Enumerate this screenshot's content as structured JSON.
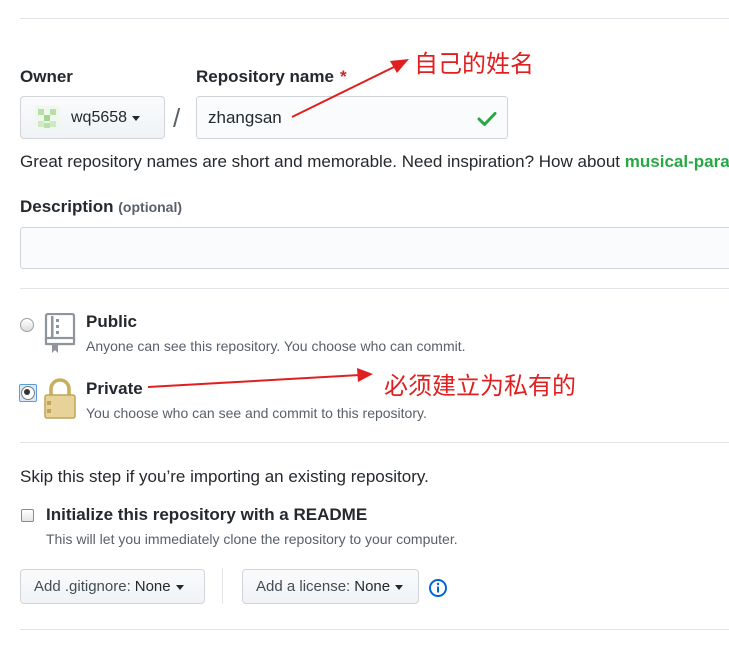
{
  "owner": {
    "label": "Owner",
    "username": "wq5658"
  },
  "repository": {
    "label": "Repository name",
    "required_mark": "*",
    "separator": "/",
    "value": "zhangsan"
  },
  "name_hint": {
    "text": "Great repository names are short and memorable. Need inspiration? How about ",
    "suggestion": "musical-parakeet"
  },
  "description": {
    "label": "Description",
    "optional": "(optional)",
    "value": ""
  },
  "visibility": {
    "public": {
      "title": "Public",
      "desc": "Anyone can see this repository. You choose who can commit.",
      "selected": false
    },
    "private": {
      "title": "Private",
      "desc": "You choose who can see and commit to this repository.",
      "selected": true
    }
  },
  "skip_text": "Skip this step if you’re importing an existing repository.",
  "readme": {
    "label": "Initialize this repository with a README",
    "desc": "This will let you immediately clone the repository to your computer.",
    "checked": false
  },
  "gitignore": {
    "label": "Add .gitignore:",
    "value": "None"
  },
  "license": {
    "label": "Add a license:",
    "value": "None"
  },
  "annotations": {
    "name_note": "自己的姓名",
    "private_note": "必须建立为私有的"
  },
  "colors": {
    "annotation": "#e02020",
    "suggestion": "#28a745",
    "info": "#0366d6"
  },
  "icons": {
    "avatar": "identicon-avatar",
    "valid": "check-icon",
    "public": "repo-book-icon",
    "private": "lock-icon",
    "info": "info-icon"
  }
}
